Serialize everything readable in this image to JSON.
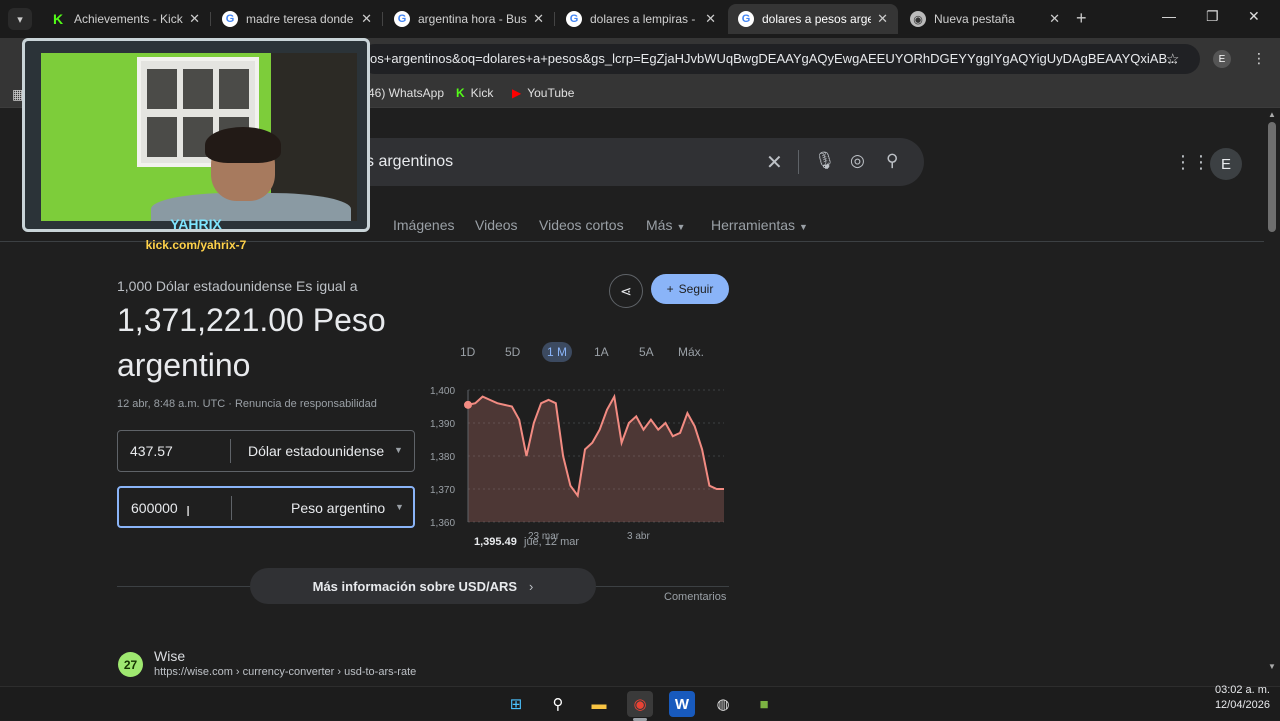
{
  "browser": {
    "tabs": [
      {
        "title": "Achievements - Kick",
        "favicon": "kick-icon",
        "active": false
      },
      {
        "title": "madre teresa donde",
        "favicon": "google-icon",
        "active": false
      },
      {
        "title": "argentina hora - Busc",
        "favicon": "google-icon",
        "active": false
      },
      {
        "title": "dolares a lempiras -",
        "favicon": "google-icon",
        "active": false
      },
      {
        "title": "dolares a pesos arge",
        "favicon": "google-icon",
        "active": true
      },
      {
        "title": "Nueva pestaña",
        "favicon": "chrome-icon",
        "active": false
      }
    ],
    "url": "os+argentinos&oq=dolares+a+pesos&gs_lcrp=EgZjaHJvbWUqBwgDEAAYgAQyEwgAEEUYORhDGEYYggIYgAQYigUyDAgBEAAYQxiAB...",
    "profile_initial": "E",
    "bookmarks": [
      {
        "label": "(46) WhatsApp"
      },
      {
        "label": "Kick"
      },
      {
        "label": "YouTube"
      }
    ]
  },
  "search": {
    "query_visible": "s argentinos",
    "avatar_initial": "E",
    "nav_tabs": [
      "Imágenes",
      "Videos",
      "Videos cortos",
      "Más",
      "Herramientas"
    ]
  },
  "converter": {
    "subtitle": "1,000 Dólar estadounidense Es igual a",
    "result": "1,371,221.00 Peso argentino",
    "meta": "12 abr, 8:48 a.m. UTC · Renuncia de responsabilidad",
    "from_value": "437.57",
    "from_currency": "Dólar estadounidense",
    "to_value": "600000",
    "to_currency": "Peso argentino",
    "follow_label": "Seguir",
    "ranges": [
      "1D",
      "5D",
      "1 M",
      "1A",
      "5A",
      "Máx."
    ],
    "active_range": "1 M",
    "more_info": "Más información sobre USD/ARS",
    "feedback": "Comentarios"
  },
  "chart_data": {
    "type": "area",
    "y_ticks": [
      "1,400",
      "1,390",
      "1,380",
      "1,370",
      "1,360"
    ],
    "ylim": [
      1360,
      1400
    ],
    "x_ticks": [
      "23 mar",
      "3 abr"
    ],
    "series": [
      {
        "values": [
          1395.5,
          1396,
          1398,
          1397,
          1396,
          1395.5,
          1395,
          1391,
          1380,
          1390,
          1396,
          1397,
          1396,
          1380,
          1371,
          1368,
          1382,
          1384,
          1388,
          1394,
          1398,
          1384,
          1390,
          1392,
          1388,
          1391,
          1388,
          1390,
          1386,
          1387,
          1393,
          1389,
          1382,
          1371,
          1370,
          1370
        ]
      }
    ],
    "tooltip_value": "1,395.49",
    "tooltip_date": "jue, 12 mar",
    "line_color": "#f28b82"
  },
  "result_wise": {
    "name": "Wise",
    "url": "https://wise.com › currency-converter › usd-to-ars-rate",
    "logo_text": "27"
  },
  "webcam": {
    "name": "YAHRIX",
    "link": "kick.com/yahrix-7"
  },
  "taskbar": {
    "time": "03:02 a. m.",
    "date": "12/04/2026"
  }
}
